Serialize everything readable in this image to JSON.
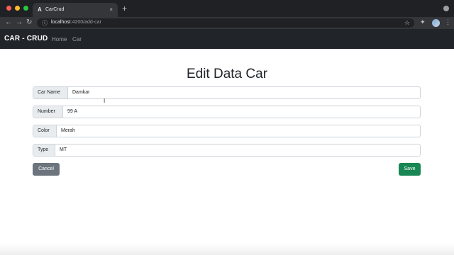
{
  "browser": {
    "tab_title": "CarCrud",
    "tab_favicon": "A",
    "tab_close": "×",
    "new_tab": "+",
    "url_host": "localhost",
    "url_rest": ":4200/add-car",
    "back_glyph": "←",
    "forward_glyph": "→",
    "reload_glyph": "↻",
    "lock_glyph": "ⓘ",
    "star_glyph": "☆",
    "extension_glyph": "✦",
    "menu_glyph": "⋮"
  },
  "navbar": {
    "brand": "CAR - CRUD",
    "links": [
      "Home",
      "Car"
    ]
  },
  "form": {
    "title": "Edit Data Car",
    "fields": [
      {
        "label": "Car Name",
        "value": "Damkar"
      },
      {
        "label": "Number",
        "value": "99 A"
      },
      {
        "label": "Color",
        "value": "Merah"
      },
      {
        "label": "Type",
        "value": "MT"
      }
    ],
    "cancel_label": "Cancel",
    "save_label": "Save"
  },
  "colors": {
    "navbar_bg": "#212529",
    "cancel_bg": "#6c757d",
    "save_bg": "#198754"
  }
}
